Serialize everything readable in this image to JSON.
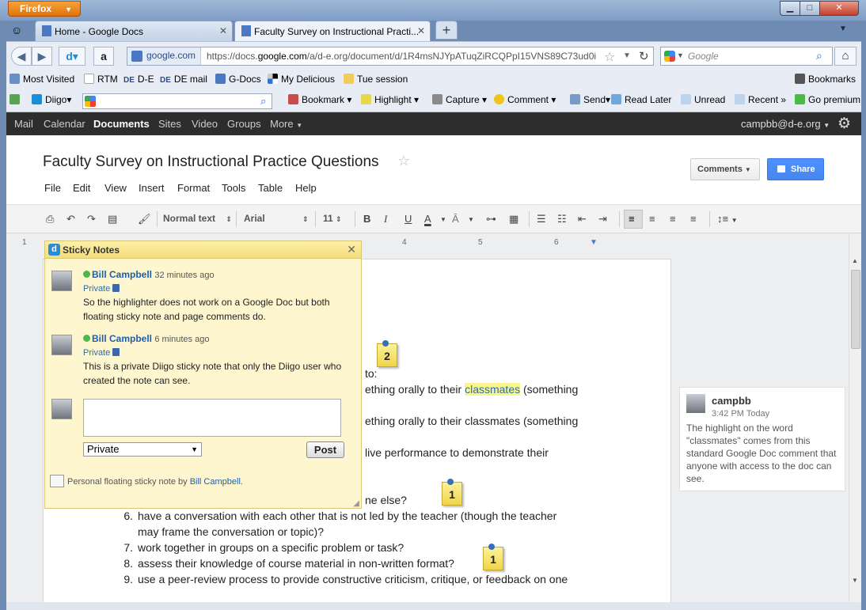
{
  "browser": {
    "app_button": "Firefox",
    "tabs": [
      {
        "label": "Home - Google Docs"
      },
      {
        "label": "Faculty Survey on Instructional Practi..."
      }
    ],
    "url_site": "google.com",
    "url_pre": "https://docs.",
    "url_domain": "google.com",
    "url_post": "/a/d-e.org/document/d/1R4msNJYpATuqZiRCQPpI15VNS89C73ud0i",
    "search_placeholder": "Google",
    "bookmarks": [
      "Most Visited",
      "RTM",
      "D-E",
      "DE mail",
      "G-Docs",
      "My Delicious",
      "Tue session"
    ],
    "bookmarks_right": "Bookmarks",
    "diigo_toolbar": [
      "Diigo",
      "Bookmark",
      "Highlight",
      "Capture",
      "Comment",
      "Send",
      "Read Later",
      "Unread",
      "Recent",
      "Go premium"
    ]
  },
  "gbar": {
    "items": [
      "Mail",
      "Calendar",
      "Documents",
      "Sites",
      "Video",
      "Groups",
      "More"
    ],
    "user": "campbb@d-e.org"
  },
  "doc": {
    "title": "Faculty Survey on Instructional Practice Questions",
    "menus": [
      "File",
      "Edit",
      "View",
      "Insert",
      "Format",
      "Tools",
      "Table",
      "Help"
    ],
    "comments_button": "Comments",
    "share_button": "Share",
    "toolbar": {
      "style": "Normal text",
      "font": "Arial",
      "size": "11"
    },
    "ruler": [
      "1",
      "4",
      "5",
      "6"
    ],
    "fragments": [
      "to:",
      "ething orally to their ",
      "classmates",
      " (something",
      "ething orally to their classmates (something",
      "live performance to demonstrate their",
      "ne else?"
    ],
    "list": [
      {
        "num": "6.",
        "text": "have a conversation with each other that is not led by the teacher (though the teacher"
      },
      {
        "num": "",
        "text": "may frame the conversation or topic)?"
      },
      {
        "num": "7.",
        "text": "work together in groups on a specific problem or task?"
      },
      {
        "num": "8.",
        "text": "assess their knowledge of course material in non-written format?"
      },
      {
        "num": "9.",
        "text": "use a peer-review process to provide constructive criticism, critique, or feedback on one"
      }
    ]
  },
  "comment": {
    "author": "campbb",
    "time": "3:42 PM Today",
    "text": "The highlight on the word \"classmates\" comes from this standard Google Doc comment that anyone with access to the doc can see."
  },
  "sticky": {
    "title": "Sticky Notes",
    "notes": [
      {
        "author": "Bill Campbell",
        "time": "32 minutes ago",
        "privacy": "Private",
        "text": "So the highlighter does not work on a Google Doc but both floating sticky note and page comments do."
      },
      {
        "author": "Bill Campbell",
        "time": "6 minutes ago",
        "privacy": "Private",
        "text": "This is a private Diigo sticky note that only the Diigo user who created the note can see."
      }
    ],
    "privacy_select": "Private",
    "post_button": "Post",
    "footer_text": "Personal floating sticky note by ",
    "footer_link": "Bill Campbell",
    "footer_end": "."
  },
  "pins": [
    "2",
    "1",
    "1"
  ],
  "colors": {
    "accent": "#4d90fe",
    "highlight": "#fbf68c",
    "sticky_bg": "#fdf6cf"
  }
}
